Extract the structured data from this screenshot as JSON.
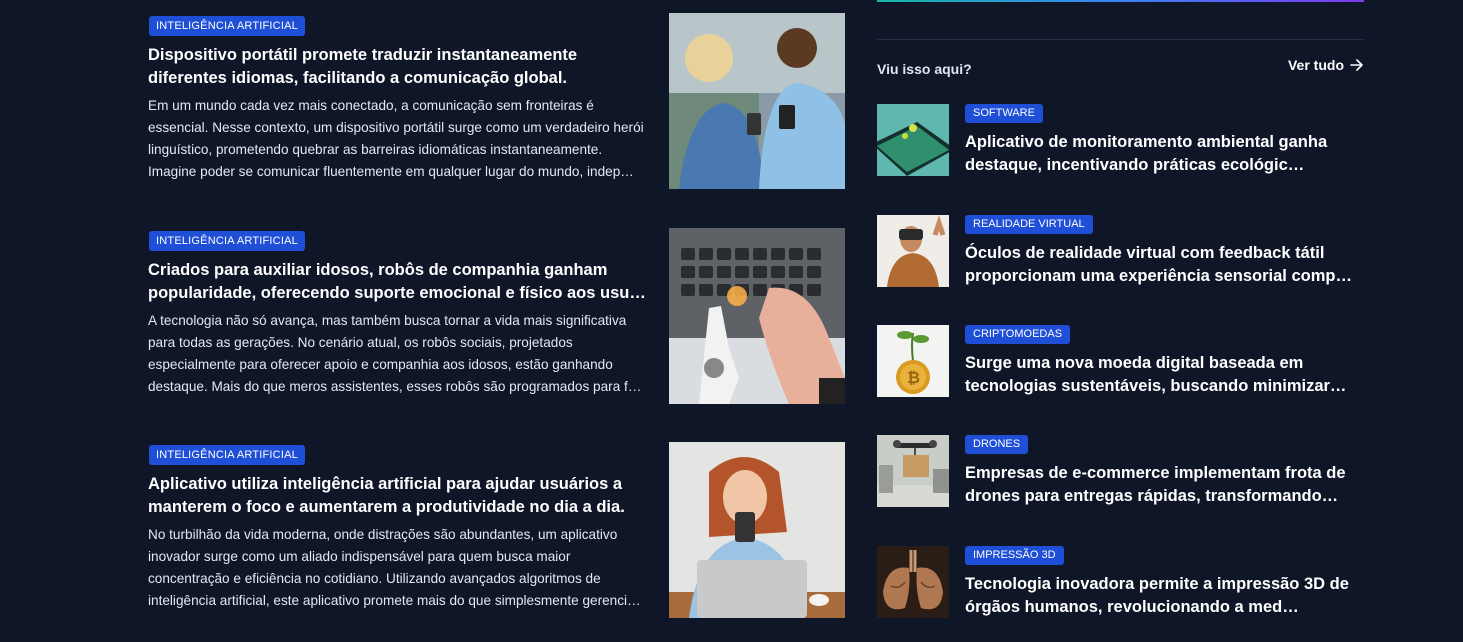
{
  "articles": [
    {
      "category": "INTELIGÊNCIA ARTIFICIAL",
      "title": "Dispositivo portátil promete traduzir instantaneamente diferentes idiomas, facilitando a comunicação global.",
      "excerpt": "Em um mundo cada vez mais conectado, a comunicação sem fronteiras é essencial. Nesse contexto, um dispositivo portátil surge como um verdadeiro herói linguístico, prometendo quebrar as barreiras idiomáticas instantaneamente. Imagine poder se comunicar fluentemente em qualquer lugar do mundo, indep…"
    },
    {
      "category": "INTELIGÊNCIA ARTIFICIAL",
      "title": "Criados para auxiliar idosos, robôs de companhia ganham popularidade, oferecendo suporte emocional e físico aos usu…",
      "excerpt": "A tecnologia não só avança, mas também busca tornar a vida mais significativa para todas as gerações. No cenário atual, os robôs sociais, projetados especialmente para oferecer apoio e companhia aos idosos, estão ganhando destaque. Mais do que meros assistentes, esses robôs são programados para f…"
    },
    {
      "category": "INTELIGÊNCIA ARTIFICIAL",
      "title": "Aplicativo utiliza inteligência artificial para ajudar usuários a manterem o foco e aumentarem a produtividade no dia a dia.",
      "excerpt": "No turbilhão da vida moderna, onde distrações são abundantes, um aplicativo inovador surge como um aliado indispensável para quem busca maior concentração e eficiência no cotidiano. Utilizando avançados algoritmos de inteligência artificial, este aplicativo promete mais do que simplesmente gerenci…"
    }
  ],
  "sidebar": {
    "section_title": "Viu isso aqui?",
    "see_all": "Ver tudo",
    "items": [
      {
        "category": "SOFTWARE",
        "title": "Aplicativo de monitoramento ambiental ganha destaque, incentivando práticas ecológic…"
      },
      {
        "category": "REALIDADE VIRTUAL",
        "title": "Óculos de realidade virtual com feedback tátil proporcionam uma experiência sensorial comp…"
      },
      {
        "category": "CRIPTOMOEDAS",
        "title": "Surge uma nova moeda digital baseada em tecnologias sustentáveis, buscando minimizar…"
      },
      {
        "category": "DRONES",
        "title": "Empresas de e-commerce implementam frota de drones para entregas rápidas, transformando…"
      },
      {
        "category": "IMPRESSÃO 3D",
        "title": "Tecnologia inovadora permite a impressão 3D de órgãos humanos, revolucionando a med…"
      }
    ]
  },
  "colors": {
    "background": "#0e1628",
    "badge": "#1f4fd6",
    "text": "#ffffff"
  },
  "icons": {
    "see_all": "arrow-right-icon"
  }
}
